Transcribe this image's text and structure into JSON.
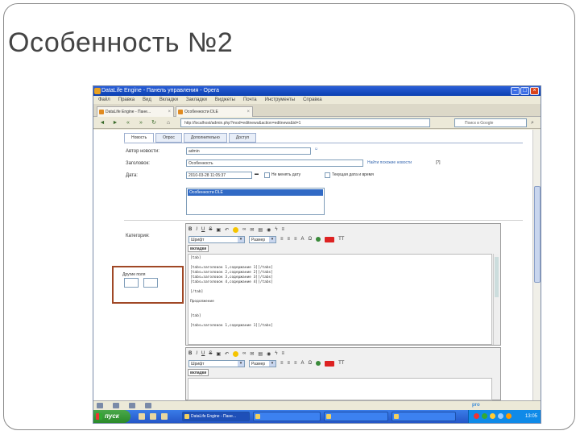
{
  "slide": {
    "title": "Особенность №2"
  },
  "window": {
    "title": "DataLife Engine - Панель управления - Opera",
    "menu": [
      "Файл",
      "Правка",
      "Вид",
      "Вкладки",
      "Закладки",
      "Виджеты",
      "Почта",
      "Инструменты",
      "Справка"
    ]
  },
  "browser_tabs": [
    {
      "label": "DataLife Engine - Пане..."
    },
    {
      "label": "Особенности DLE"
    }
  ],
  "navbar": {
    "url": "http://localhost/admin.php?mod=editnews&action=editnews&id=1",
    "search_placeholder": "Поиск в Google"
  },
  "page_tabs": [
    "Новость",
    "Опрос",
    "Дополнительно",
    "Доступ"
  ],
  "form": {
    "author_label": "Автор новости:",
    "author_value": "admin",
    "title_label": "Заголовок:",
    "title_value": "Особенность",
    "title_check_link": "Найти похожие новости",
    "date_label": "Дата:",
    "date_value": "2010-03-28 11:05:37",
    "not_update_date": "Не менять дату",
    "current_date": "Текущая дата и время",
    "category_label": "Категория:",
    "category_selected": "Особенности DLE"
  },
  "editor": {
    "font_family": "Шрифт",
    "font_size": "Размер",
    "tab_label": "вкладки",
    "short_text": "[tab]\n\n[tabs=заголовок 1,содержание 1][/tabs]\n[tabs=заголовок 2,содержание 2][/tabs]\n[tabs=заголовок 3,содержание 3][/tabs]\n[tabs=заголовок 4,содержание 4][/tabs]\n\n[/tab]\n\nПродолжение\n\n\n[tab]\n\n[tabs=заголовок 1,содержание 1][/tabs]"
  },
  "highlight": {
    "label": "Другие поля"
  },
  "taskbar": {
    "start": "пуск",
    "buttons": [
      "DataLife Engine - Пане...",
      "",
      "",
      "",
      ""
    ],
    "clock": "13:05"
  },
  "status_bar": {
    "brand": "pro"
  }
}
